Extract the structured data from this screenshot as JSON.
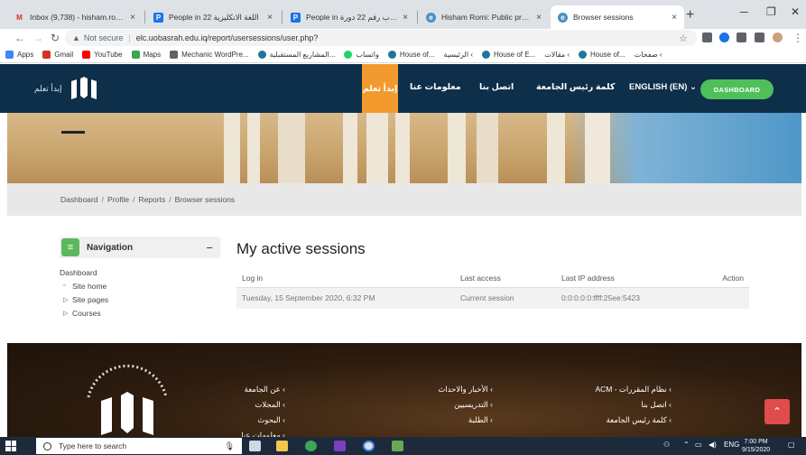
{
  "browser": {
    "tabs": [
      {
        "title": "Inbox (9,738) - hisham.romi@",
        "icon": "gmail-icon",
        "color": "#d93025",
        "glyph": "M"
      },
      {
        "title": "People in اللغة الانكليزية 22",
        "icon": "people-icon",
        "color": "#1a73e8",
        "glyph": "P"
      },
      {
        "title": "People in الحاسوب رقم 22 دورة",
        "icon": "people-icon",
        "color": "#1a73e8",
        "glyph": "P"
      },
      {
        "title": "Hisham Romi: Public profile",
        "icon": "moodle-icon",
        "color": "#4a90c2",
        "glyph": "e"
      },
      {
        "title": "Browser sessions",
        "icon": "moodle-icon",
        "color": "#4a90c2",
        "glyph": "e"
      }
    ],
    "not_secure": "Not secure",
    "url": "elc.uobasrah.edu.iq/report/usersessions/user.php?",
    "bookmarks": [
      {
        "label": "Apps",
        "color": "#4285f4"
      },
      {
        "label": "Gmail",
        "color": "#d93025"
      },
      {
        "label": "YouTube",
        "color": "#ff0000"
      },
      {
        "label": "Maps",
        "color": "#34a853"
      },
      {
        "label": "Mechanic WordPre...",
        "color": "#5f6368"
      },
      {
        "label": "المشاريع المستقبلية...",
        "color": "#21759b"
      },
      {
        "label": "واتساب",
        "color": "#25d366"
      },
      {
        "label": "House of...",
        "color": "#21759b"
      },
      {
        "label": "الرئيسية ‹",
        "color": "#21759b"
      },
      {
        "label": "House of E...",
        "color": "#21759b"
      },
      {
        "label": "مقالات ‹",
        "color": "#21759b"
      },
      {
        "label": "House of...",
        "color": "#21759b"
      },
      {
        "label": "صفحات ‹",
        "color": "#21759b"
      }
    ]
  },
  "site": {
    "logo_text": "إبدأ تعلم",
    "nav": {
      "active": "إبدأ تعلم",
      "about": "معلومات عنا",
      "contact": "اتصل بنا",
      "president": "كلمة رئيس الجامعة",
      "language": "ENGLISH (EN)",
      "dashboard": "DASHBOARD"
    },
    "breadcrumb": [
      "Dashboard",
      "Profile",
      "Reports",
      "Browser sessions"
    ],
    "navigation": {
      "title": "Navigation",
      "items": [
        {
          "label": "Dashboard",
          "indent": 0,
          "bullet": ""
        },
        {
          "label": "Site home",
          "indent": 1,
          "bullet": "▫"
        },
        {
          "label": "Site pages",
          "indent": 1,
          "bullet": "▷"
        },
        {
          "label": "Courses",
          "indent": 1,
          "bullet": "▷"
        }
      ]
    },
    "sessions": {
      "title": "My active sessions",
      "headers": [
        "Log in",
        "Last access",
        "Last IP address",
        "Action"
      ],
      "rows": [
        [
          "Tuesday, 15 September 2020, 6:32 PM",
          "Current session",
          "0:0:0:0:0:ffff:25ee:5423",
          ""
        ]
      ]
    },
    "footer": {
      "col1": [
        "عن الجامعة ‹",
        "المجلات ‹",
        "البحوث ‹",
        "معلومات عنا ‹"
      ],
      "col2": [
        "الأخبار والاحداث ‹",
        "التدريسيين ‹",
        "الطلبة ‹"
      ],
      "col3": [
        "ACM - نظام المقررات ‹",
        "اتصل بنا ‹",
        "كلمة رئيس الجامعة ‹"
      ]
    }
  },
  "taskbar": {
    "search_placeholder": "Type here to search",
    "lang": "ENG",
    "time": "7:00 PM",
    "date": "9/15/2020"
  }
}
